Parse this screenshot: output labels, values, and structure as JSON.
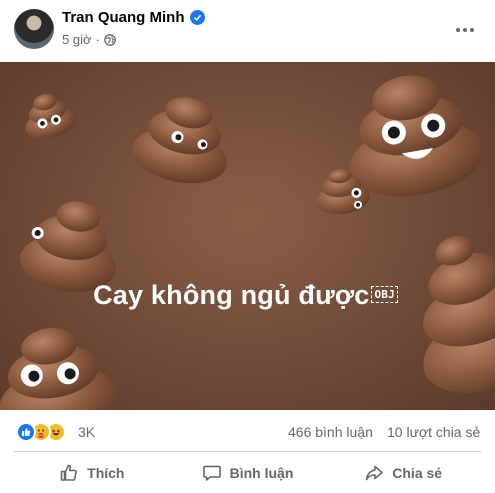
{
  "post": {
    "author": "Tran Quang Minh",
    "time": "5 giờ",
    "caption": "Cay không ngủ được",
    "caption_obj": "OBJ"
  },
  "stats": {
    "reactions": "3K",
    "comments": "466 bình luận",
    "shares": "10 lượt chia sẻ"
  },
  "actions": {
    "like": "Thích",
    "comment": "Bình luận",
    "share": "Chia sẻ"
  },
  "icons": {
    "verified": "verified-badge-icon",
    "privacy": "globe-icon",
    "more": "more-options-icon",
    "reaction_1": "like-reaction-icon",
    "reaction_2": "care-reaction-icon",
    "reaction_3": "haha-reaction-icon"
  },
  "colors": {
    "accent": "#1877f2",
    "image_background": "#6f4a37",
    "secondary_text": "#65676b"
  }
}
